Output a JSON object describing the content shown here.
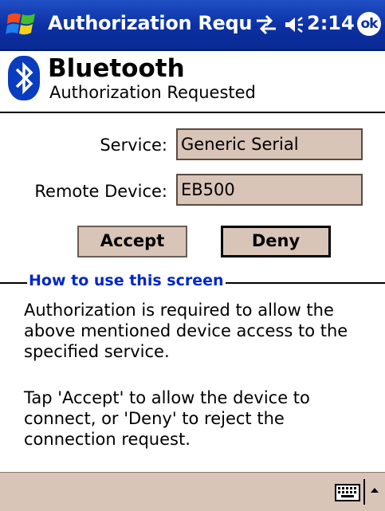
{
  "titlebar": {
    "title": "Authorization Requ",
    "time": "2:14",
    "ok_label": "ok",
    "icons": [
      "windows-start-icon",
      "connectivity-icon",
      "volume-icon"
    ],
    "color": "#0b2fa3"
  },
  "header": {
    "title": "Bluetooth",
    "subtitle": "Authorization Requested",
    "icon": "bluetooth-icon",
    "icon_color": "#0a3cc0"
  },
  "form": {
    "service_label": "Service:",
    "service_value": "Generic Serial",
    "device_label": "Remote Device:",
    "device_value": "EB500",
    "field_color": "#d9c4b8"
  },
  "buttons": {
    "accept": "Accept",
    "deny": "Deny"
  },
  "help": {
    "heading": "How to use this screen",
    "heading_color": "#0027c8",
    "paragraph1": "Authorization is required to allow the above mentioned device access to the specified service.",
    "paragraph2": "Tap 'Accept' to allow the device to connect, or 'Deny' to reject the connection request."
  },
  "bottom_bar": {
    "icons": [
      "keyboard-icon",
      "up-arrow-icon"
    ]
  }
}
